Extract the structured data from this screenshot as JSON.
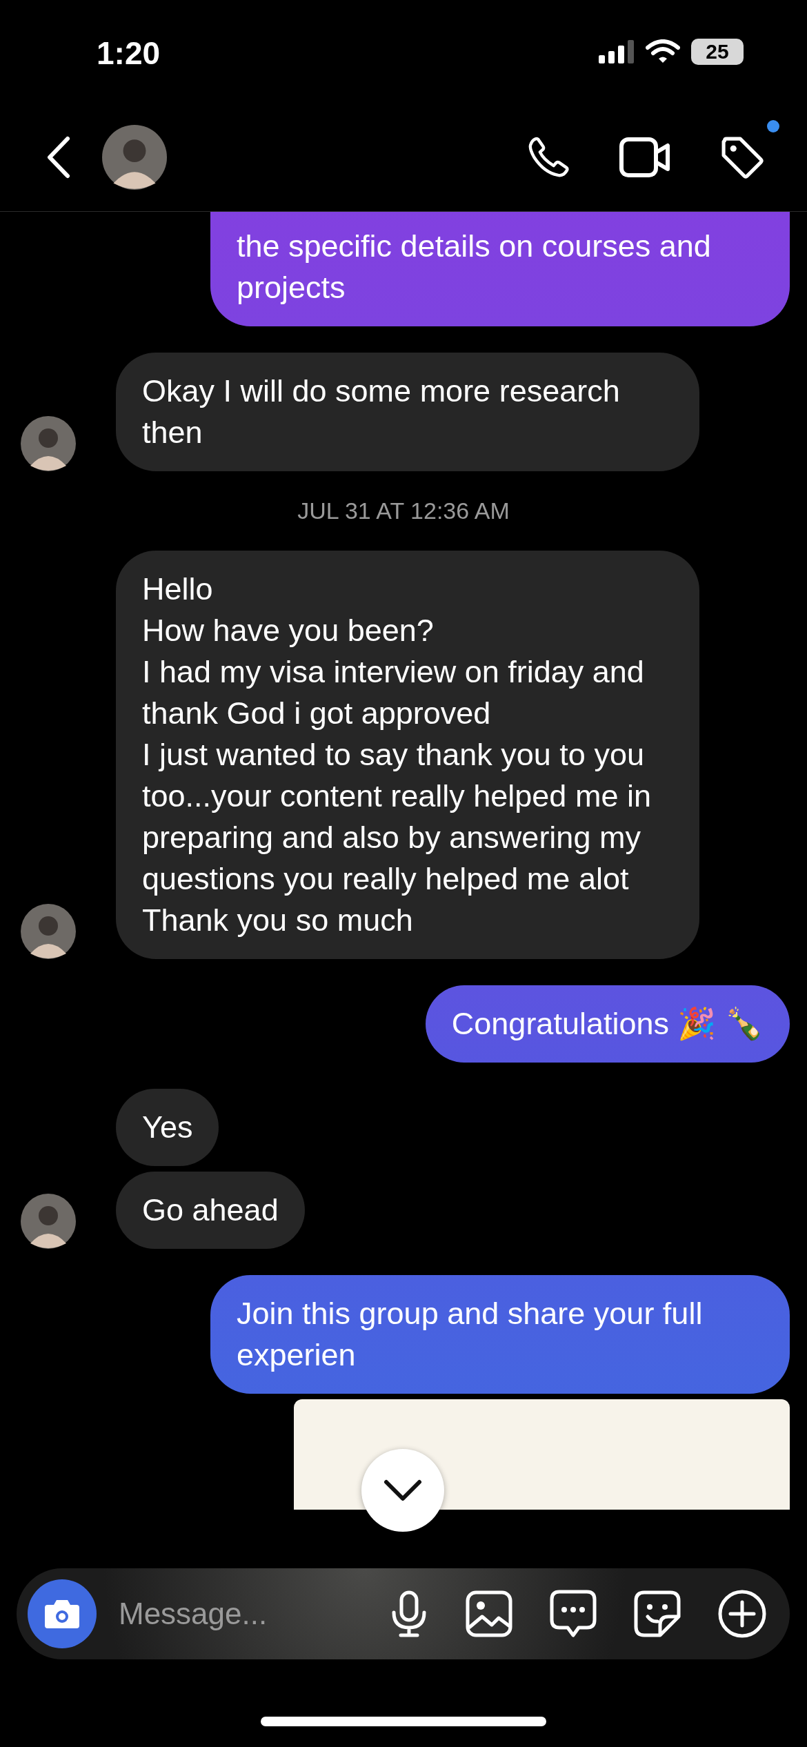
{
  "status_bar": {
    "time": "1:20",
    "battery": "25"
  },
  "header": {
    "notification": true
  },
  "messages": [
    {
      "kind": "sent",
      "text": "the specific details on courses and projects",
      "cut_top": true
    },
    {
      "kind": "received",
      "text": "Okay I will do some more research then"
    },
    {
      "kind": "timestamp",
      "text": "JUL 31 AT 12:36 AM"
    },
    {
      "kind": "received",
      "text": "Hello\nHow have you been?\nI had my visa interview on friday and thank God i got approved\nI just wanted to say thank you to you too...your content really helped me in preparing and also by answering my questions you really helped me alot\nThank you so much"
    },
    {
      "kind": "sent",
      "text": "Congratulations 🎉 🍾"
    },
    {
      "kind": "received",
      "text": "Yes"
    },
    {
      "kind": "received",
      "text": "Go ahead"
    },
    {
      "kind": "sent",
      "text": "Join this group and share your full experien"
    },
    {
      "kind": "post"
    }
  ],
  "composer": {
    "placeholder": "Message..."
  }
}
